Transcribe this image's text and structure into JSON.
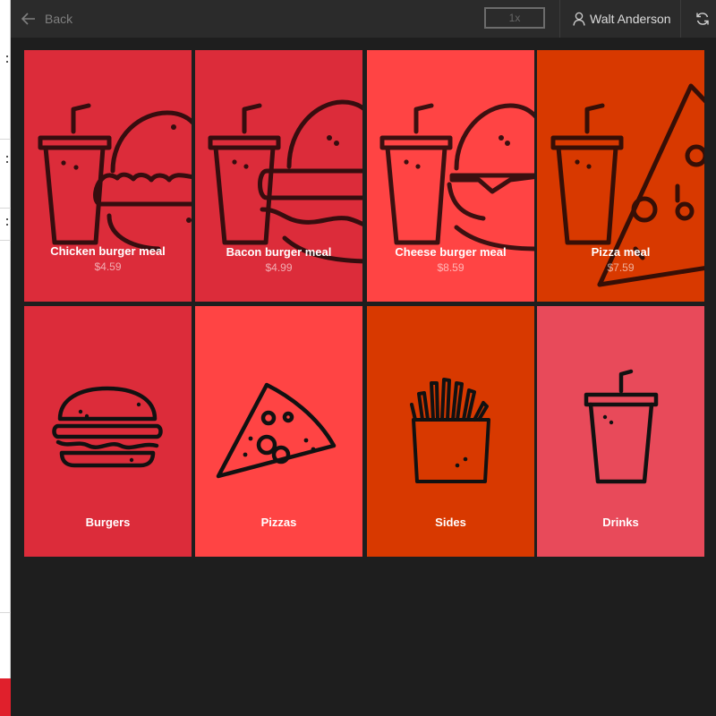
{
  "topbar": {
    "back_label": "Back",
    "speed_value": "1x",
    "user_name": "Walt Anderson"
  },
  "meals": [
    {
      "name": "Chicken burger meal",
      "price": "$4.59",
      "color": "#dc2c3a",
      "icon": "chicken-burger-meal-icon"
    },
    {
      "name": "Bacon burger meal",
      "price": "$4.99",
      "color": "#dc2c3a",
      "icon": "bacon-burger-meal-icon"
    },
    {
      "name": "Cheese burger meal",
      "price": "$8.59",
      "color": "#ff4444",
      "icon": "cheese-burger-meal-icon"
    },
    {
      "name": "Pizza meal",
      "price": "$7.59",
      "color": "#d83900",
      "icon": "pizza-meal-icon"
    }
  ],
  "categories": [
    {
      "name": "Burgers",
      "color": "#dc2c3a",
      "icon": "burger-icon"
    },
    {
      "name": "Pizzas",
      "color": "#ff4444",
      "icon": "pizza-slice-icon"
    },
    {
      "name": "Sides",
      "color": "#d83900",
      "icon": "fries-icon"
    },
    {
      "name": "Drinks",
      "color": "#e84a5a",
      "icon": "drink-cup-icon"
    }
  ]
}
